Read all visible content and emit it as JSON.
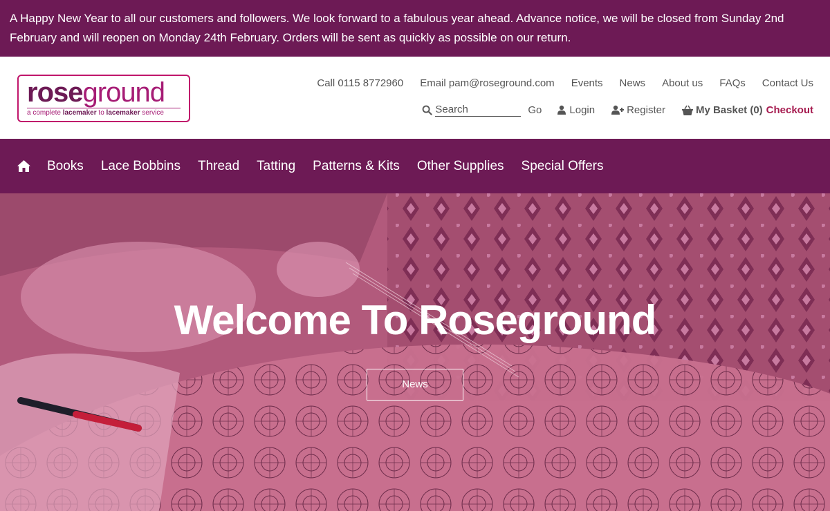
{
  "notice": {
    "text": "A Happy New Year to all our customers and followers. We look forward to a fabulous year ahead. Advance notice, we will be closed from Sunday 2nd February and will reopen on Monday 24th February. Orders will be sent as quickly as possible on our return."
  },
  "logo": {
    "rose": "rose",
    "ground": "ground",
    "tagline_pre": "a complete ",
    "tagline_b1": "lacemaker",
    "tagline_mid": " to ",
    "tagline_b2": "lacemaker",
    "tagline_post": " service"
  },
  "toplinks": {
    "call": "Call 0115 8772960",
    "email": "Email pam@roseground.com",
    "events": "Events",
    "news": "News",
    "about": "About us",
    "faqs": "FAQs",
    "contact": "Contact Us"
  },
  "utility": {
    "search_placeholder": "Search",
    "go": "Go",
    "login": "Login",
    "register": "Register",
    "basket": "My Basket (0)",
    "checkout": "Checkout"
  },
  "nav": {
    "items": [
      "Books",
      "Lace Bobbins",
      "Thread",
      "Tatting",
      "Patterns & Kits",
      "Other Supplies",
      "Special Offers"
    ]
  },
  "hero": {
    "title": "Welcome To Roseground",
    "button": "News"
  },
  "colors": {
    "brand_purple": "#6d1a55",
    "brand_pink": "#a61c75",
    "checkout": "#a61c50",
    "hero_overlay": "#b86080"
  },
  "icons": [
    "home-icon",
    "search-icon",
    "user-icon",
    "user-plus-icon",
    "basket-icon"
  ]
}
